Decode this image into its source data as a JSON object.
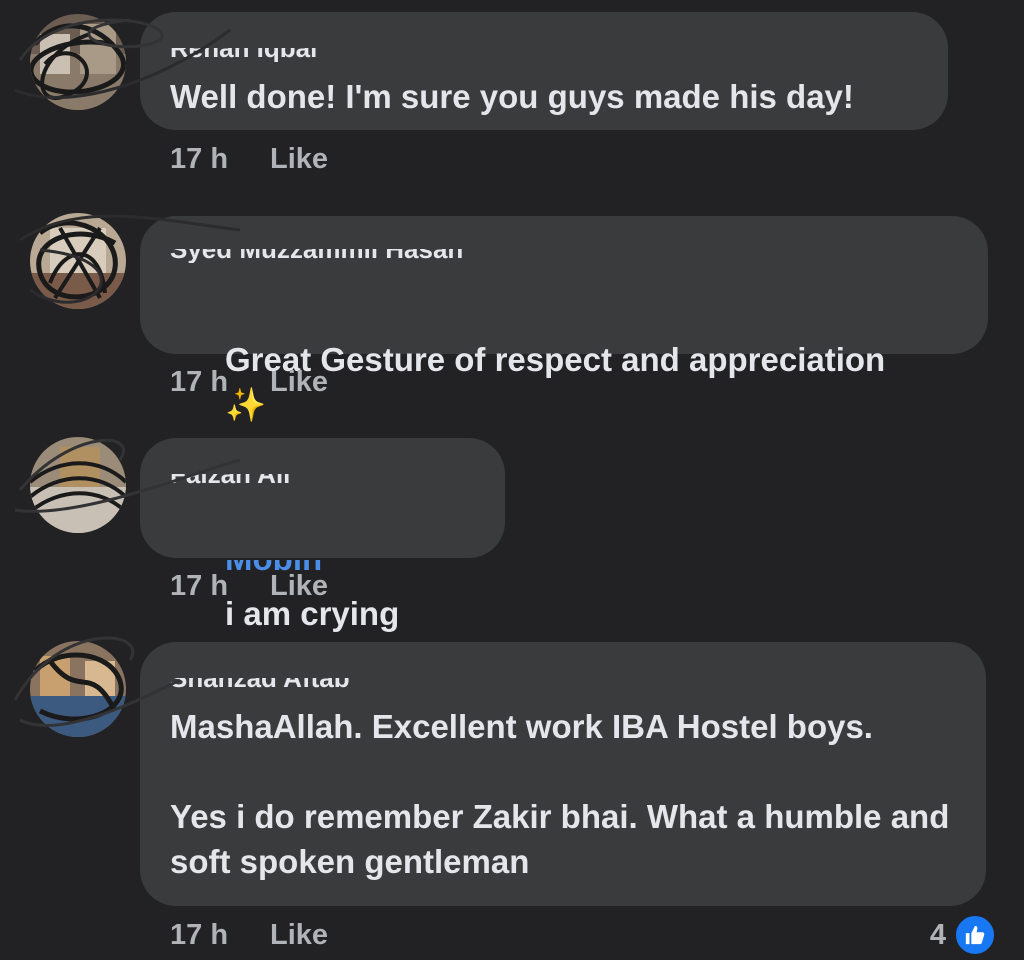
{
  "comments": [
    {
      "author": "Rehan Iqbal",
      "text": "Well done! I'm sure you guys made his day!",
      "time": "17 h",
      "like_label": "Like"
    },
    {
      "author": "Syed Muzzammil Hasan",
      "text": "Great Gesture of respect and appreciation",
      "emoji": "✨",
      "time": "17 h",
      "like_label": "Like"
    },
    {
      "author": "Faizan Ali",
      "mention": "Mobin",
      "text": "i am crying",
      "time": "17 h",
      "like_label": "Like"
    },
    {
      "author": "Shahzad Aftab",
      "text": "MashaAllah. Excellent work IBA Hostel boys.\n\nYes i do remember Zakir bhai. What a humble and soft spoken gentleman",
      "time": "17 h",
      "like_label": "Like",
      "reaction_count": "4",
      "reaction_icon": "thumbs-up-icon"
    }
  ],
  "colors": {
    "background": "#222224",
    "bubble": "#3a3b3c",
    "text": "#e4e6eb",
    "meta": "#b0b3b8",
    "mention": "#4b8ee8",
    "reaction": "#1877f2"
  }
}
